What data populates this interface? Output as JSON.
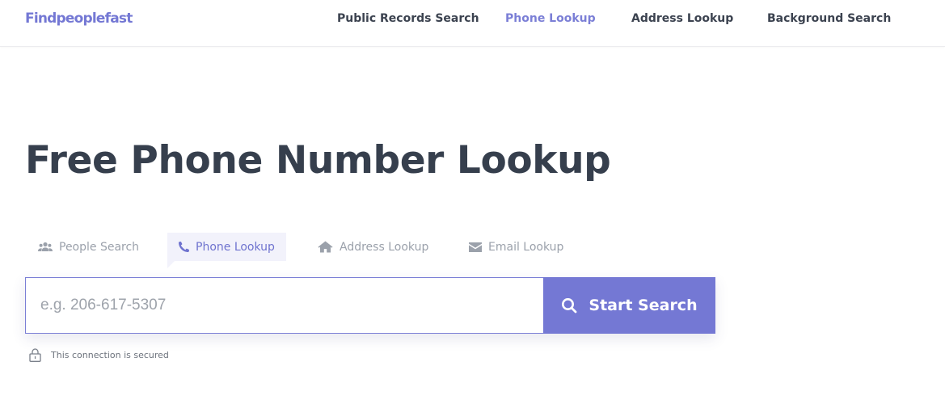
{
  "header": {
    "logo": "Findpeoplefast",
    "nav": [
      {
        "label": "Public Records Search",
        "active": false
      },
      {
        "label": "Phone Lookup",
        "active": true
      },
      {
        "label": "Address Lookup",
        "active": false
      },
      {
        "label": "Background Search",
        "active": false
      }
    ]
  },
  "hero": {
    "title": "Free Phone Number Lookup"
  },
  "tabs": [
    {
      "label": "People Search",
      "icon": "people-icon",
      "active": false
    },
    {
      "label": "Phone Lookup",
      "icon": "phone-icon",
      "active": true
    },
    {
      "label": "Address Lookup",
      "icon": "home-icon",
      "active": false
    },
    {
      "label": "Email Lookup",
      "icon": "envelope-icon",
      "active": false
    }
  ],
  "search": {
    "placeholder": "e.g. 206-617-5307",
    "value": "",
    "button_label": "Start Search",
    "button_icon": "search-icon"
  },
  "security": {
    "text": "This connection is secured",
    "icon": "lock-icon"
  },
  "colors": {
    "brand": "#7478d4",
    "heading": "#363f4d",
    "nav_text": "#3c4350",
    "muted": "#9ba1ab",
    "active_tab_bg": "#f2f2fb"
  }
}
